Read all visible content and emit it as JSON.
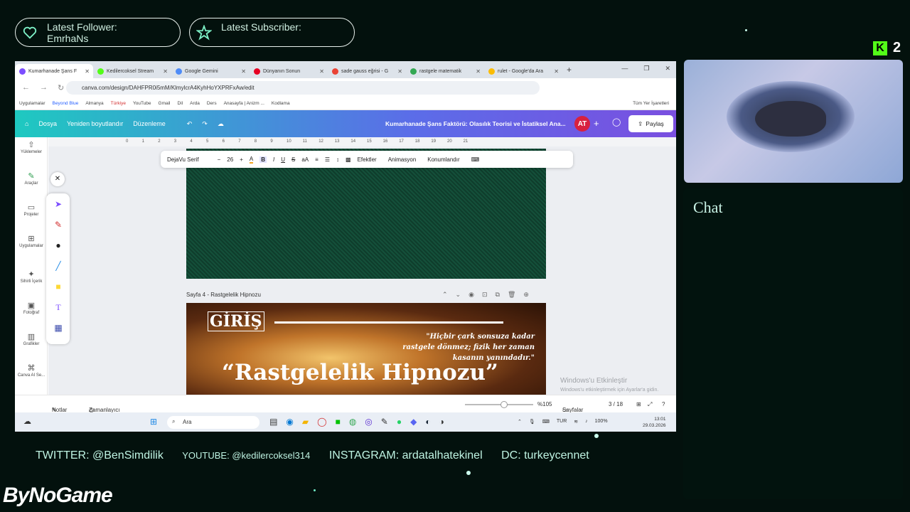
{
  "overlay": {
    "follower_label": "Latest Follower:",
    "follower_name": "EmrhaNs",
    "subscriber_label": "Latest Subscriber:",
    "kick_count": "2",
    "chat_title": "Chat",
    "socials": [
      "TWITTER: @BenSimdilik",
      "YOUTUBE: @kedilercoksel314",
      "INSTAGRAM: ardatalhatekinel",
      "DC: turkeycennet"
    ],
    "brand": "ByNoGame"
  },
  "browser": {
    "tabs": [
      {
        "label": "Kumarhanade Şans F",
        "color": "#7c4dff",
        "active": true
      },
      {
        "label": "Kedilercoksel Stream",
        "color": "#53fc18",
        "active": false
      },
      {
        "label": "Google Gemini",
        "color": "#4f8cf7",
        "active": false
      },
      {
        "label": "Dünyanın Sonun",
        "color": "#e60023",
        "active": false
      },
      {
        "label": "sade gauss eğrisi - G",
        "color": "#ea4335",
        "active": false
      },
      {
        "label": "rastgele matematik",
        "color": "#34a853",
        "active": false
      },
      {
        "label": "rulet - Google'da Ara",
        "color": "#fbbc05",
        "active": false
      }
    ],
    "url": "canva.com/design/DAHFPR0i5mM/KlmylcrA4KyhHoYXPRFxAw/edit",
    "bookmarks": [
      "Uygulamalar",
      "Beyond Blue",
      "Almanya",
      "Türkiye",
      "YouTube",
      "Gmail",
      "Dil",
      "Arda",
      "Ders",
      "Anasayfa | Anizm ...",
      "Kodlama"
    ],
    "bookmarks_right": "Tüm Yer İşaretleri"
  },
  "canva": {
    "menu": [
      "Dosya",
      "Yeniden boyutlandır",
      "Düzenleme"
    ],
    "doc_title": "Kumarhanade Şans Faktörü: Olasılık Teorisi ve İstatiksel Ana...",
    "avatar": "AT",
    "share": "Paylaş",
    "rail": [
      "Yüklemeler",
      "Araçlar",
      "Projeler",
      "Uygulamalar",
      "Sihirli İçerik",
      "Fotoğraf",
      "Grafikler",
      "Canva AI Se..."
    ],
    "font": "DejaVu Serif",
    "font_size": "26",
    "effects": "Efektler",
    "animation": "Animasyon",
    "position": "Konumlandır",
    "ruler": [
      "0",
      "1",
      "2",
      "3",
      "4",
      "5",
      "6",
      "7",
      "8",
      "9",
      "10",
      "11",
      "12",
      "13",
      "14",
      "15",
      "16",
      "17",
      "18",
      "19",
      "20",
      "21"
    ],
    "page_label": "Sayfa 4 - Rastgelelik Hipnozu",
    "slide": {
      "heading": "GİRİŞ",
      "quote": "\"Hiçbir çark sonsuza kadar rastgele dönmez; fizik her zaman kasanın yanındadır.\"",
      "title": "“Rastgelelik Hipnozu”"
    },
    "notes": "Notlar",
    "timer": "Zamanlayıcı",
    "zoom": "%105",
    "pages_label": "Sayfalar",
    "page_count": "3 / 18",
    "win_activate": "Windows'u Etkinleştir",
    "win_activate_sub": "Windows'u etkinleştirmek için Ayarlar'a gidin."
  },
  "taskbar": {
    "search": "Ara",
    "lang": "TUR",
    "battery": "100%",
    "time": "13:01",
    "date": "29.03.2026"
  }
}
